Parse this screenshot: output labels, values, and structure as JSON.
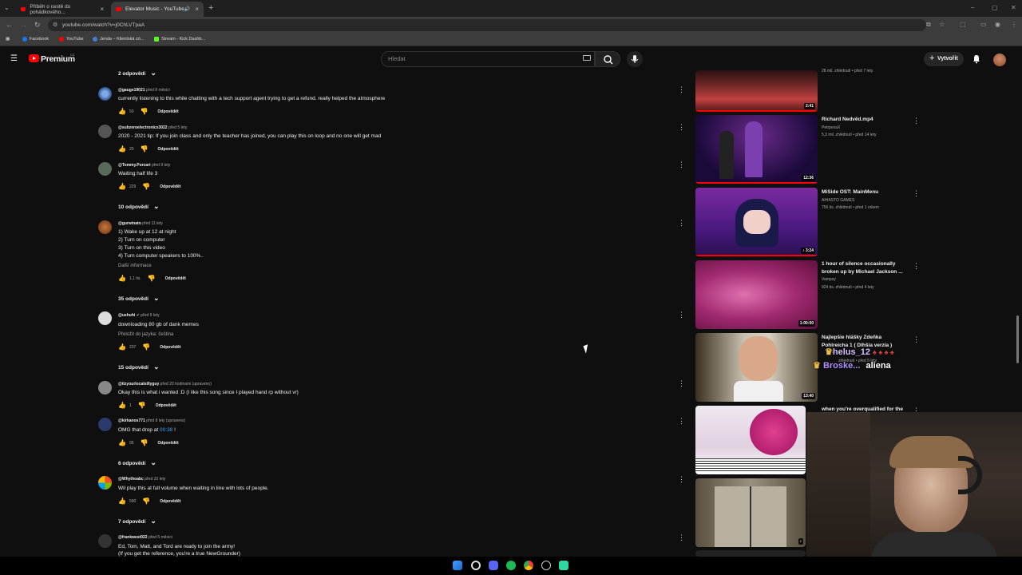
{
  "browser": {
    "tabs": [
      {
        "title": "Příběh o cestě do pohádkového...",
        "active": false
      },
      {
        "title": "Elevator Music - YouTube",
        "active": true
      }
    ],
    "url": "youtube.com/watch?v=j0ChLVTpaA",
    "bookmarks": [
      "Facebook",
      "YouTube",
      "Jenda – Klientská zó...",
      "Stream - Kick Dashb..."
    ]
  },
  "youtube_header": {
    "logo": "Premium",
    "region": "CZ",
    "search_placeholder": "Hledat",
    "create_label": "Vytvořit"
  },
  "comments_top": {
    "replies_label": "2 odpovědi"
  },
  "comments": [
    {
      "handle": "@gauge19021",
      "time": "před 8 měsíci",
      "text": [
        "currently listening to this while chatting with a tech support agent trying to get a refund. really helped the atmosphere"
      ],
      "likes": "50",
      "reply": "Odpovědět",
      "replies": ""
    },
    {
      "handle": "@subzeroelectronics3022",
      "time": "před 5 lety",
      "text": [
        "2020 - 2021 tip: If you join class and only the teacher has joined, you can play this on loop and no one will get mad"
      ],
      "likes": "20",
      "reply": "Odpovědět",
      "replies": ""
    },
    {
      "handle": "@Tommy.Porcari",
      "time": "před 9 lety",
      "text": [
        "Waiting half life 3"
      ],
      "likes": "229",
      "reply": "Odpovědět",
      "replies": "10 odpovědí"
    },
    {
      "handle": "@gurwinato",
      "time": "před 11 lety",
      "text": [
        "1) Wake up at 12 at night",
        "2) Turn on computer",
        "3) Turn on this video",
        "4) Turn computer speakers to 100%.."
      ],
      "more": "Další informace",
      "likes": "1,1 tis.",
      "reply": "Odpovědět",
      "replies": "35 odpovědí"
    },
    {
      "handle": "@ushuhi",
      "time": "před 9 lety",
      "text": [
        "downloading 80 gb of dank memes"
      ],
      "translate": "Přeložit do jazyka: čeština",
      "likes": "237",
      "reply": "Odpovědět",
      "replies": "15 odpovědí"
    },
    {
      "handle": "@itzyourlocalsillyguy",
      "time": "před 20 hodinami (upraveno)",
      "text": [
        "Okay this is what i wanted :D (I like this song since I played hand rp without vr)"
      ],
      "likes": "1",
      "reply": "Odpovědět",
      "replies": ""
    },
    {
      "handle": "@kirkanos771",
      "time": "před 8 lety (upraveno)",
      "text_prefix": "OMG that drop at ",
      "timestamp": "00:38",
      "text_suffix": " !",
      "likes": "95",
      "reply": "Odpovědět",
      "replies": "6 odpovědí"
    },
    {
      "handle": "@Whythoabc",
      "time": "před 10 lety",
      "text": [
        "Wil play this at full volume when waiting in line with lots of people."
      ],
      "likes": "590",
      "reply": "Odpovědět",
      "replies": "7 odpovědí"
    },
    {
      "handle": "@frankwest022",
      "time": "před 5 měsíci",
      "text": [
        "Ed, Tom, Matt, and Tord are ready to join the army!",
        "(If you get the reference, you're a true NewGrounder)"
      ]
    }
  ],
  "sidebar": [
    {
      "title": "",
      "channel": "",
      "meta": "28 mil. zhlédnutí • před 7 lety",
      "duration": "2:41"
    },
    {
      "title": "Richard Nedvěd.mp4",
      "channel": "PetrpexaX",
      "meta": "5,3 mil. zhlédnutí • před 14 lety",
      "duration": "12:36"
    },
    {
      "title": "MiSide OST: MainMenu",
      "channel": "AIHASTO GAMES",
      "meta": "756 tis. zhlédnutí • před 1 rokem",
      "duration": "3:24"
    },
    {
      "title": "1 hour of silence occasionally broken up by Michael Jackson ...",
      "channel": "Vampsy",
      "meta": "924 tis. zhlédnutí • před 4 lety",
      "duration": "1:00:00"
    },
    {
      "title": "Najlepšie hlášky Zdeňka Pohlreicha 1 ( Dlhšia verzia )",
      "channel": "K...",
      "meta": "zhlédnutí • před 5 lety",
      "duration": "13:40"
    },
    {
      "title": "when you're overqualified for the",
      "channel": "",
      "meta": "",
      "duration": ""
    }
  ],
  "chat_overlay": {
    "line1": "helus_12",
    "line2_user": "Broske...",
    "line2_msg": "aliena"
  },
  "colors": {
    "background": "#0f0f0f",
    "accent": "#ff0000",
    "link": "#3ea6ff"
  }
}
